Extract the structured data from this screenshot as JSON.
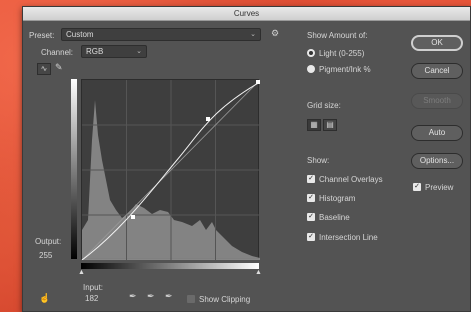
{
  "window": {
    "title": "Curves"
  },
  "preset": {
    "label": "Preset:",
    "value": "Custom"
  },
  "channel": {
    "label": "Channel:",
    "value": "RGB"
  },
  "show_amount": {
    "title": "Show Amount of:",
    "options": [
      "Light (0-255)",
      "Pigment/Ink %"
    ],
    "selected": 0
  },
  "grid_size": {
    "title": "Grid size:"
  },
  "show": {
    "title": "Show:",
    "items": [
      {
        "label": "Channel Overlays",
        "checked": true
      },
      {
        "label": "Histogram",
        "checked": true
      },
      {
        "label": "Baseline",
        "checked": true
      },
      {
        "label": "Intersection Line",
        "checked": true
      }
    ]
  },
  "buttons": {
    "ok": "OK",
    "cancel": "Cancel",
    "smooth": "Smooth",
    "auto": "Auto",
    "options": "Options..."
  },
  "preview": {
    "label": "Preview",
    "checked": true
  },
  "output": {
    "label": "Output:",
    "value": "255"
  },
  "input": {
    "label": "Input:",
    "value": "182"
  },
  "show_clipping": {
    "label": "Show Clipping"
  },
  "icons": {
    "check_mark": "✓",
    "chevron": "⌄",
    "gear": "⚙"
  }
}
